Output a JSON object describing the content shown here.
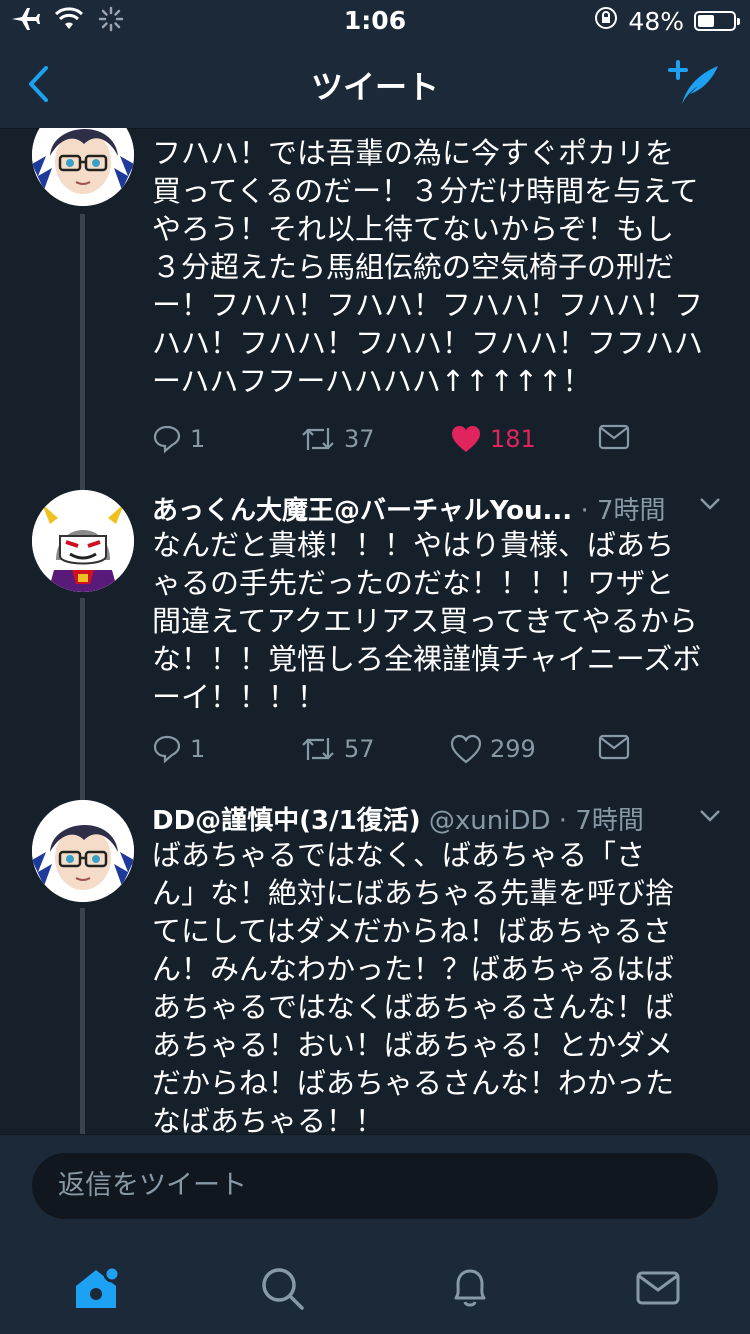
{
  "status_bar": {
    "time": "1:06",
    "battery": "48%"
  },
  "navbar": {
    "title": "ツイート"
  },
  "tweets": [
    {
      "lines": [
        "フハハ！では吾輩の為に今すぐポカリを",
        "買ってくるのだー！３分だけ時間を与えて",
        "やろう！それ以上待てないからぞ！もし",
        "３分超えたら馬組伝統の空気椅子の刑だ",
        "ー！フハハ！フハハ！フハハ！フハハ！フ",
        "ハハ！フハハ！フハハ！フハハ！フフハハ",
        "ーハハフフーハハハハ↑↑↑↑↑！"
      ],
      "replies": "1",
      "retweets": "37",
      "likes": "181"
    },
    {
      "name": "あっくん大魔王@バーチャルYou...",
      "time": "7時間",
      "lines": [
        "なんだと貴様！！！やはり貴様、ばあち",
        "ゃるの手先だったのだな！！！！ワザと",
        "間違えてアクエリアス買ってきてやるから",
        "な！！！覚悟しろ全裸謹慎チャイニーズボ",
        "ーイ！！！！"
      ],
      "replies": "1",
      "retweets": "57",
      "likes": "299"
    },
    {
      "name": "DD@謹慎中(3/1復活)",
      "handle": "@xuniDD",
      "time": "7時間",
      "lines": [
        "ばあちゃるではなく、ばあちゃる「さ",
        "ん」な！絶対にばあちゃる先輩を呼び捨",
        "てにしてはダメだからね！ばあちゃるさ",
        "ん！みんなわかった！？ばあちゃるはば",
        "あちゃるではなくばあちゃるさんな！ば",
        "あちゃる！おい！ばあちゃる！とかダメ",
        "だからね！ばあちゃるさんな！わかった",
        "なばあちゃる！！"
      ]
    }
  ],
  "reply": {
    "placeholder": "返信をツイート"
  },
  "colors": {
    "accent": "#1da1f2",
    "like": "#e0245e",
    "background": "#15202b",
    "muted": "#8899a6"
  }
}
